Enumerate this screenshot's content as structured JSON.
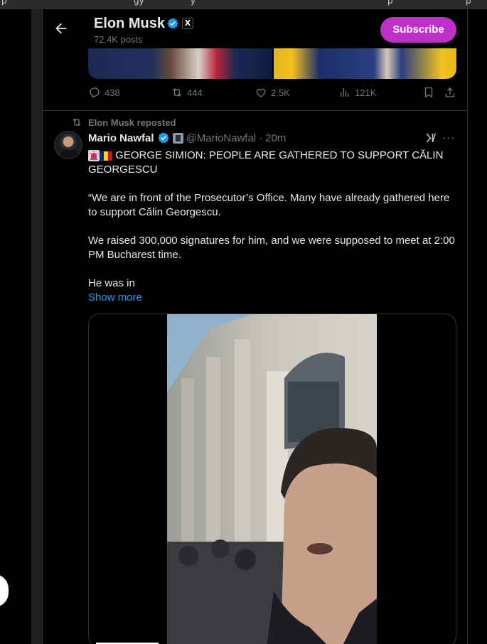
{
  "browser": {
    "tab_fragments": [
      "p",
      "gy",
      "y",
      "p",
      "p"
    ]
  },
  "header": {
    "name": "Elon Musk",
    "posts": "72.4K posts",
    "subscribe_label": "Subscribe",
    "x_badge": "X"
  },
  "previous_post": {
    "replies": "438",
    "reposts": "444",
    "likes": "2.5K",
    "views": "121K"
  },
  "repost_label": "Elon Musk reposted",
  "post": {
    "author": "Mario Nawfal",
    "handle": "@MarioNawfal",
    "separator": "·",
    "time": "20m",
    "line1": "GEORGE SIMION: PEOPLE ARE GATHERED TO SUPPORT CĂLIN GEORGESCU",
    "para1": "“We are in front of the Prosecutor’s Office. Many have already gathered here to support Călin Georgescu.",
    "para2": "We raised 300,000 signatures for him, and we were supposed to meet at 2:00 PM Bucharest time.",
    "para3": "He was in",
    "show_more": "Show more",
    "more_glyph": "···"
  },
  "footer": {
    "dots": "..."
  },
  "colors": {
    "subscribe_bg": "#c02fc8",
    "link": "#1d9bf0",
    "verified": "#1d9bf0",
    "muted": "#71767b"
  },
  "icons": [
    "back-arrow-icon",
    "verified-icon",
    "x-badge-icon",
    "reply-icon",
    "repost-icon",
    "like-icon",
    "views-icon",
    "bookmark-icon",
    "share-icon",
    "grok-icon",
    "more-icon",
    "siren-icon",
    "romania-flag-icon"
  ]
}
